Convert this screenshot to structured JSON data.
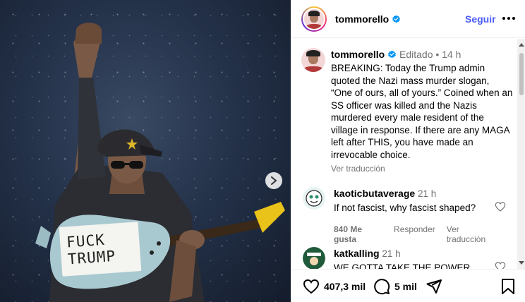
{
  "post": {
    "sign_text": "FUCK TRUMP"
  },
  "header": {
    "username": "tommorello",
    "follow_label": "Seguir"
  },
  "caption": {
    "username": "tommorello",
    "edited_label": "Editado",
    "separator": "•",
    "time": "14 h",
    "text": "BREAKING: Today the Trump admin quoted the Nazi mass murder slogan, “One of ours, all of yours.” Coined when an SS officer was killed and the Nazis murdered every male resident of the village in response. If there are any MAGA left after THIS, you have made an irrevocable choice.",
    "translate_label": "Ver traducción"
  },
  "comments": [
    {
      "username": "kaoticbutaverage",
      "time": "21 h",
      "text": "If not fascist, why fascist shaped?",
      "likes": "840 Me gusta",
      "reply_label": "Responder",
      "translate_label": "Ver traducción"
    },
    {
      "username": "katkalling",
      "time": "21 h",
      "text": "WE GOTTA TAKE THE POWER BACK"
    }
  ],
  "actions": {
    "likes_count": "407,3 mil",
    "comments_count": "5 mil"
  },
  "colors": {
    "link": "#4a5df9",
    "verified": "#0095f6",
    "muted": "#737373"
  }
}
